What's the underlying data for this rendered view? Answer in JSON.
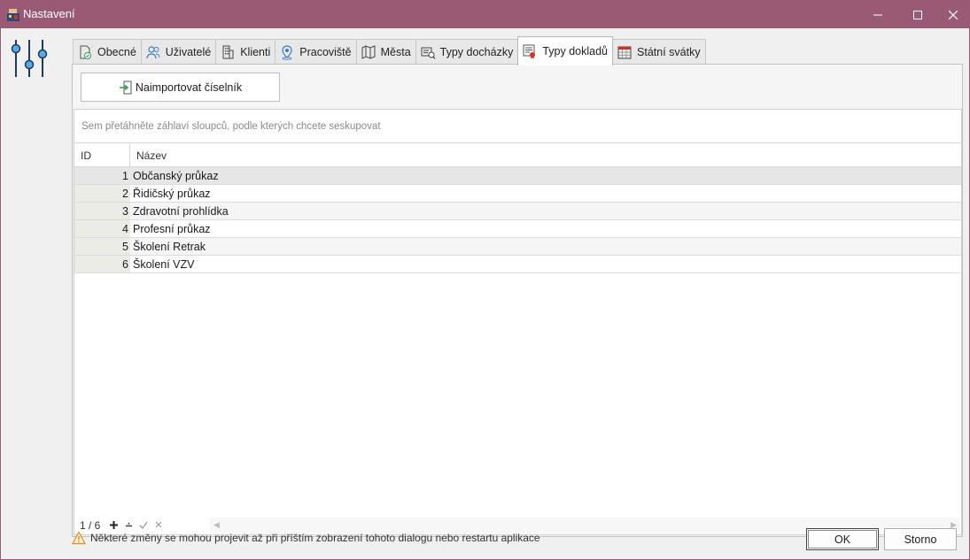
{
  "window": {
    "title": "Nastavení"
  },
  "tabs": [
    {
      "label": "Obecné",
      "icon": "document-check-icon"
    },
    {
      "label": "Uživatelé",
      "icon": "users-icon"
    },
    {
      "label": "Klienti",
      "icon": "building-icon"
    },
    {
      "label": "Pracoviště",
      "icon": "location-pin-icon"
    },
    {
      "label": "Města",
      "icon": "map-icon"
    },
    {
      "label": "Typy docházky",
      "icon": "attendance-icon"
    },
    {
      "label": "Typy dokladů",
      "icon": "id-card-icon",
      "active": true
    },
    {
      "label": "Státní svátky",
      "icon": "calendar-icon"
    }
  ],
  "toolbar": {
    "import_label": "Naimportovat číselník"
  },
  "grid": {
    "group_panel_text": "Sem přetáhněte záhlaví sloupců, podle kterých chcete seskupovat",
    "columns": [
      "ID",
      "Název"
    ],
    "rows": [
      {
        "id": "1",
        "name": "Občanský průkaz"
      },
      {
        "id": "2",
        "name": "Řidičský průkaz"
      },
      {
        "id": "3",
        "name": "Zdravotní prohlídka"
      },
      {
        "id": "4",
        "name": "Profesní průkaz"
      },
      {
        "id": "5",
        "name": "Školení Retrak"
      },
      {
        "id": "6",
        "name": "Školení VZV"
      }
    ],
    "pager": "1 / 6"
  },
  "footer": {
    "warning": "Některé změny se mohou projevit až při příštím zobrazení tohoto dialogu nebo restartu aplikace",
    "ok_label": "OK",
    "cancel_label": "Storno"
  },
  "colors": {
    "titlebar": "#9a5a74",
    "accent": "#2f8fd8"
  }
}
